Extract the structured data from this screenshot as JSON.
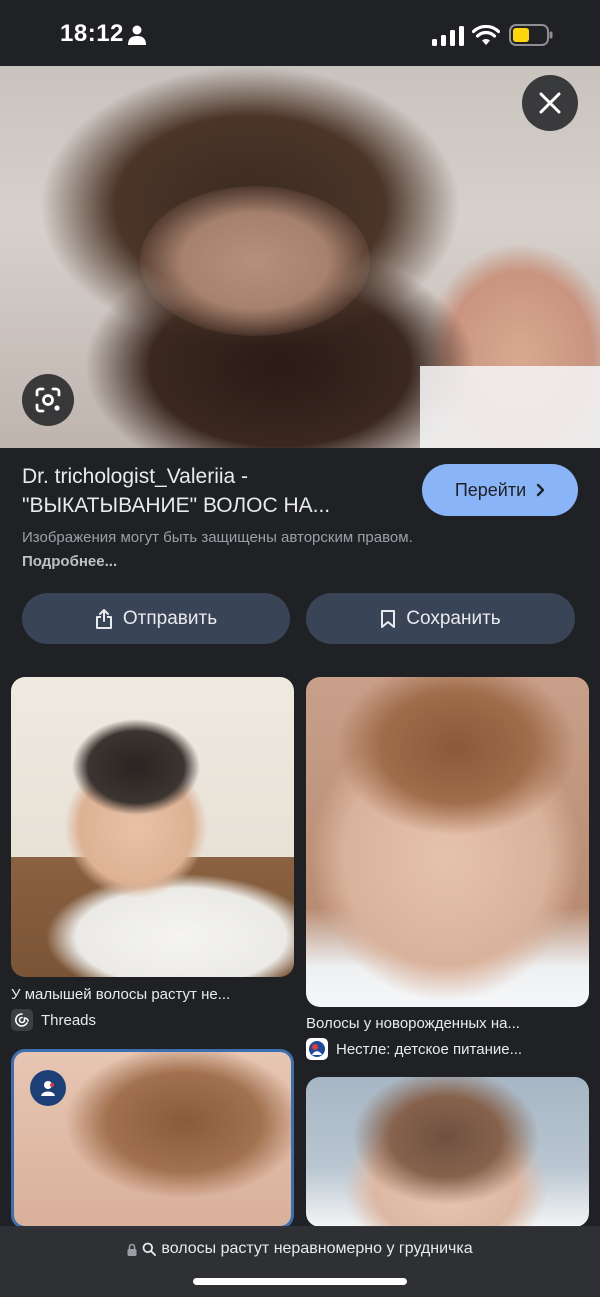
{
  "status_bar": {
    "time": "18:12",
    "battery_color": "#ffd60a"
  },
  "hero": {
    "close_icon": "close-icon",
    "lens_icon": "lens-icon"
  },
  "result": {
    "title_line1": "Dr. trichologist_Valeriia -",
    "title_line2": "\"ВЫКАТЫВАНИЕ\" ВОЛОС НА...",
    "goto_label": "Перейти",
    "copyright_text": "Изображения могут быть защищены авторским правом.",
    "copyright_more": "Подробнее..."
  },
  "actions": {
    "share_label": "Отправить",
    "save_label": "Сохранить"
  },
  "related": [
    {
      "caption": "У малышей волосы растут не...",
      "source": "Threads"
    },
    {
      "caption": "Волосы у новорожденных на...",
      "source": "Нестле: детское питание..."
    }
  ],
  "url_bar": {
    "text": "волосы растут неравномерно у грудничка"
  },
  "colors": {
    "accent": "#8ab4f8",
    "button_bg": "#394457",
    "background": "#202124"
  }
}
